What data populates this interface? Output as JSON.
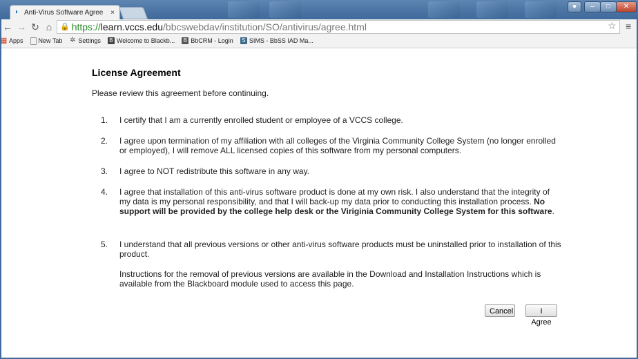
{
  "browser": {
    "tab_title": "Anti-Virus Software Agree",
    "tab_close": "×",
    "url": {
      "scheme": "https://",
      "host": "learn.vccs.edu",
      "path": "/bbcswebdav/institution/SO/antivirus/agree.html"
    },
    "bookmarks": [
      {
        "label": "Apps",
        "icon": "apps-grid-icon"
      },
      {
        "label": "New Tab",
        "icon": "page-icon"
      },
      {
        "label": "Settings",
        "icon": "gear-icon"
      },
      {
        "label": "Welcome to Blackb...",
        "icon": "blackboard-icon"
      },
      {
        "label": "BbCRM - Login",
        "icon": "bbcrm-icon"
      },
      {
        "label": "SIMS - BbSS IAD Ma...",
        "icon": "sims-icon"
      }
    ]
  },
  "page": {
    "heading": "License Agreement",
    "intro": "Please review this agreement before continuing.",
    "items": [
      {
        "num": "1.",
        "text": "I certify that I am a currently enrolled student or employee of a VCCS college."
      },
      {
        "num": "2.",
        "text": "I agree upon termination of my affiliation with all colleges of the Virginia Community College System (no longer enrolled or employed), I will remove ALL licensed copies of this software from my personal computers."
      },
      {
        "num": "3.",
        "text": "I agree to NOT redistribute this software in any way."
      },
      {
        "num": "4.",
        "text": "I agree that installation of this anti-virus software product is done at my own risk. I also understand that the integrity of my data is my personal responsibility, and that I will back-up my data prior to conducting this installation process. ",
        "bold": "No support will be provided by the college help desk or the Viriginia Community College System for this software",
        "tail": "."
      },
      {
        "num": "5.",
        "text": "I understand that all previous versions or other anti-virus software products must be uninstalled prior to installation of this product."
      }
    ],
    "note": "Instructions for the removal of previous versions are available in the Download and Installation Instructions which is available from the Blackboard module used to access this page.",
    "cancel_label": "Cancel",
    "agree_label": "I Agree"
  }
}
